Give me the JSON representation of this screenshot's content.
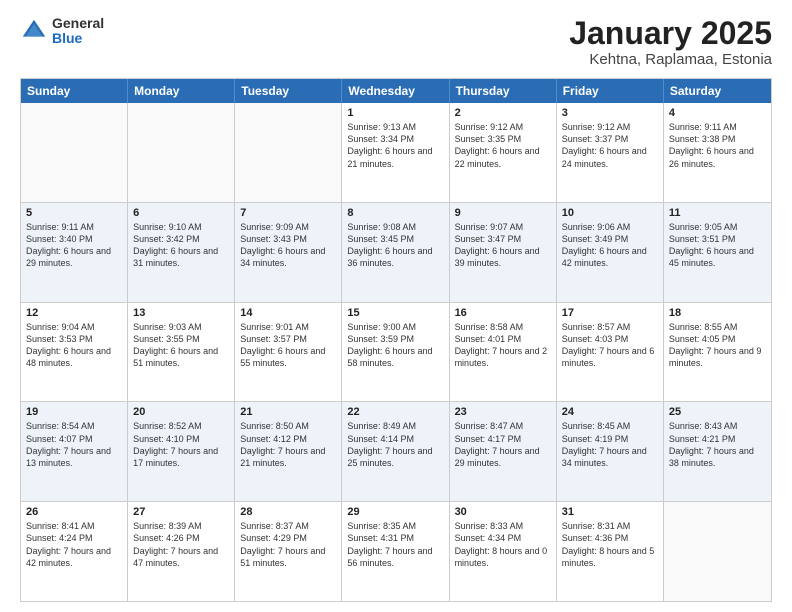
{
  "header": {
    "logo_general": "General",
    "logo_blue": "Blue",
    "title": "January 2025",
    "subtitle": "Kehtna, Raplamaa, Estonia"
  },
  "days_of_week": [
    "Sunday",
    "Monday",
    "Tuesday",
    "Wednesday",
    "Thursday",
    "Friday",
    "Saturday"
  ],
  "weeks": [
    [
      {
        "day": "",
        "info": ""
      },
      {
        "day": "",
        "info": ""
      },
      {
        "day": "",
        "info": ""
      },
      {
        "day": "1",
        "info": "Sunrise: 9:13 AM\nSunset: 3:34 PM\nDaylight: 6 hours and 21 minutes."
      },
      {
        "day": "2",
        "info": "Sunrise: 9:12 AM\nSunset: 3:35 PM\nDaylight: 6 hours and 22 minutes."
      },
      {
        "day": "3",
        "info": "Sunrise: 9:12 AM\nSunset: 3:37 PM\nDaylight: 6 hours and 24 minutes."
      },
      {
        "day": "4",
        "info": "Sunrise: 9:11 AM\nSunset: 3:38 PM\nDaylight: 6 hours and 26 minutes."
      }
    ],
    [
      {
        "day": "5",
        "info": "Sunrise: 9:11 AM\nSunset: 3:40 PM\nDaylight: 6 hours and 29 minutes."
      },
      {
        "day": "6",
        "info": "Sunrise: 9:10 AM\nSunset: 3:42 PM\nDaylight: 6 hours and 31 minutes."
      },
      {
        "day": "7",
        "info": "Sunrise: 9:09 AM\nSunset: 3:43 PM\nDaylight: 6 hours and 34 minutes."
      },
      {
        "day": "8",
        "info": "Sunrise: 9:08 AM\nSunset: 3:45 PM\nDaylight: 6 hours and 36 minutes."
      },
      {
        "day": "9",
        "info": "Sunrise: 9:07 AM\nSunset: 3:47 PM\nDaylight: 6 hours and 39 minutes."
      },
      {
        "day": "10",
        "info": "Sunrise: 9:06 AM\nSunset: 3:49 PM\nDaylight: 6 hours and 42 minutes."
      },
      {
        "day": "11",
        "info": "Sunrise: 9:05 AM\nSunset: 3:51 PM\nDaylight: 6 hours and 45 minutes."
      }
    ],
    [
      {
        "day": "12",
        "info": "Sunrise: 9:04 AM\nSunset: 3:53 PM\nDaylight: 6 hours and 48 minutes."
      },
      {
        "day": "13",
        "info": "Sunrise: 9:03 AM\nSunset: 3:55 PM\nDaylight: 6 hours and 51 minutes."
      },
      {
        "day": "14",
        "info": "Sunrise: 9:01 AM\nSunset: 3:57 PM\nDaylight: 6 hours and 55 minutes."
      },
      {
        "day": "15",
        "info": "Sunrise: 9:00 AM\nSunset: 3:59 PM\nDaylight: 6 hours and 58 minutes."
      },
      {
        "day": "16",
        "info": "Sunrise: 8:58 AM\nSunset: 4:01 PM\nDaylight: 7 hours and 2 minutes."
      },
      {
        "day": "17",
        "info": "Sunrise: 8:57 AM\nSunset: 4:03 PM\nDaylight: 7 hours and 6 minutes."
      },
      {
        "day": "18",
        "info": "Sunrise: 8:55 AM\nSunset: 4:05 PM\nDaylight: 7 hours and 9 minutes."
      }
    ],
    [
      {
        "day": "19",
        "info": "Sunrise: 8:54 AM\nSunset: 4:07 PM\nDaylight: 7 hours and 13 minutes."
      },
      {
        "day": "20",
        "info": "Sunrise: 8:52 AM\nSunset: 4:10 PM\nDaylight: 7 hours and 17 minutes."
      },
      {
        "day": "21",
        "info": "Sunrise: 8:50 AM\nSunset: 4:12 PM\nDaylight: 7 hours and 21 minutes."
      },
      {
        "day": "22",
        "info": "Sunrise: 8:49 AM\nSunset: 4:14 PM\nDaylight: 7 hours and 25 minutes."
      },
      {
        "day": "23",
        "info": "Sunrise: 8:47 AM\nSunset: 4:17 PM\nDaylight: 7 hours and 29 minutes."
      },
      {
        "day": "24",
        "info": "Sunrise: 8:45 AM\nSunset: 4:19 PM\nDaylight: 7 hours and 34 minutes."
      },
      {
        "day": "25",
        "info": "Sunrise: 8:43 AM\nSunset: 4:21 PM\nDaylight: 7 hours and 38 minutes."
      }
    ],
    [
      {
        "day": "26",
        "info": "Sunrise: 8:41 AM\nSunset: 4:24 PM\nDaylight: 7 hours and 42 minutes."
      },
      {
        "day": "27",
        "info": "Sunrise: 8:39 AM\nSunset: 4:26 PM\nDaylight: 7 hours and 47 minutes."
      },
      {
        "day": "28",
        "info": "Sunrise: 8:37 AM\nSunset: 4:29 PM\nDaylight: 7 hours and 51 minutes."
      },
      {
        "day": "29",
        "info": "Sunrise: 8:35 AM\nSunset: 4:31 PM\nDaylight: 7 hours and 56 minutes."
      },
      {
        "day": "30",
        "info": "Sunrise: 8:33 AM\nSunset: 4:34 PM\nDaylight: 8 hours and 0 minutes."
      },
      {
        "day": "31",
        "info": "Sunrise: 8:31 AM\nSunset: 4:36 PM\nDaylight: 8 hours and 5 minutes."
      },
      {
        "day": "",
        "info": ""
      }
    ]
  ]
}
